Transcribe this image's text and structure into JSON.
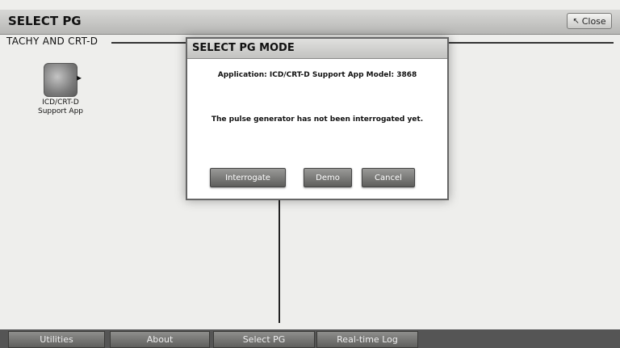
{
  "window": {
    "title": "SELECT PG",
    "close_label": "Close"
  },
  "section": {
    "label": "TACHY AND CRT-D"
  },
  "apps": [
    {
      "label_line1": "ICD/CRT-D",
      "label_line2": "Support App"
    }
  ],
  "dialog": {
    "title": "SELECT PG MODE",
    "application_text": "Application: ICD/CRT-D Support App Model: 3868",
    "message": "The pulse generator has not been interrogated yet.",
    "buttons": {
      "interrogate": "Interrogate",
      "demo": "Demo",
      "cancel": "Cancel"
    }
  },
  "bottom_tabs": [
    "Utilities",
    "About",
    "Select PG",
    "Real-time Log"
  ],
  "icons": {
    "app": "app-icon",
    "close": "close-arrow-icon"
  }
}
